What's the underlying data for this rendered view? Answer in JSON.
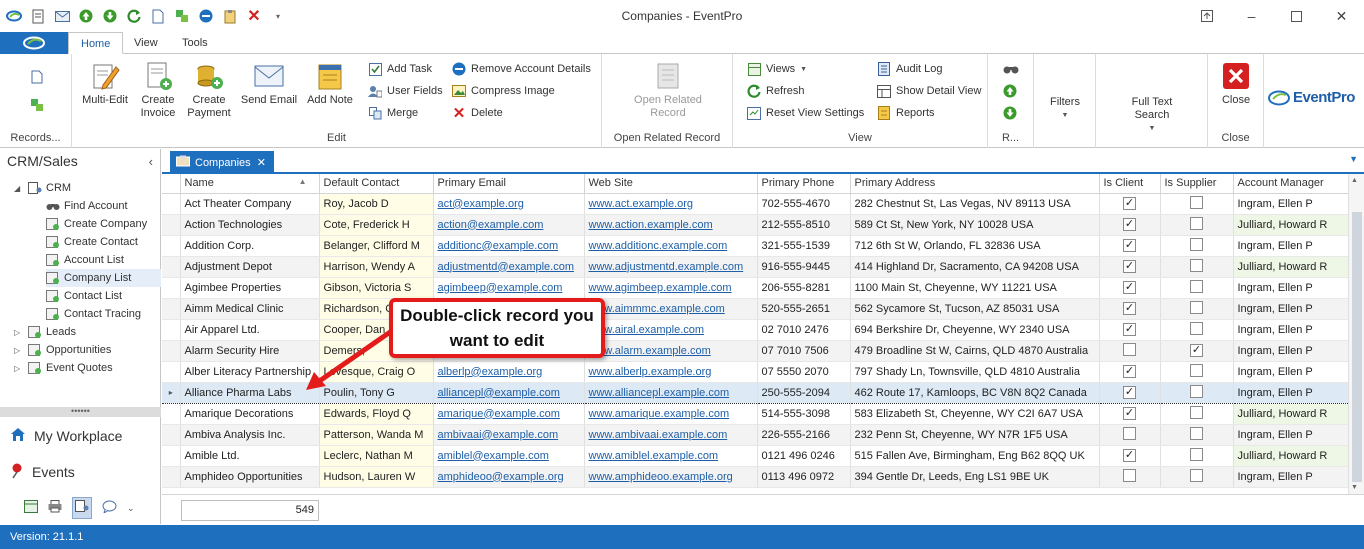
{
  "window": {
    "title": "Companies - EventPro"
  },
  "ribbon_tabs": [
    "Home",
    "View",
    "Tools"
  ],
  "ribbon": {
    "records_group": {
      "label": "Records..."
    },
    "edit_group": {
      "label": "Edit",
      "multi_edit": "Multi-Edit",
      "create_invoice": "Create\nInvoice",
      "create_payment": "Create\nPayment",
      "send_email": "Send Email",
      "add_note": "Add Note",
      "add_task": "Add Task",
      "user_fields": "User Fields",
      "merge": "Merge",
      "remove_account_details": "Remove Account Details",
      "compress_image": "Compress Image",
      "delete": "Delete"
    },
    "open_related_group": {
      "label": "Open Related Record",
      "open_related": "Open Related\nRecord"
    },
    "view_group": {
      "label": "View",
      "views": "Views",
      "refresh": "Refresh",
      "reset_view_settings": "Reset View Settings",
      "audit_log": "Audit Log",
      "show_detail_view": "Show Detail View",
      "reports": "Reports"
    },
    "r_group": {
      "label": "R..."
    },
    "filters": "Filters",
    "full_text_search": "Full Text\nSearch",
    "close_group": {
      "label": "Close",
      "close": "Close"
    },
    "logo": "EventPro"
  },
  "nav": {
    "header": "CRM/Sales",
    "tree": [
      {
        "label": "CRM",
        "icon": "crm-icon"
      },
      {
        "label": "Find Account",
        "icon": "binoculars-icon"
      },
      {
        "label": "Create Company",
        "icon": "create-company-icon"
      },
      {
        "label": "Create Contact",
        "icon": "create-contact-icon"
      },
      {
        "label": "Account List",
        "icon": "account-list-icon"
      },
      {
        "label": "Company List",
        "icon": "company-list-icon",
        "selected": true
      },
      {
        "label": "Contact List",
        "icon": "contact-list-icon"
      },
      {
        "label": "Contact Tracing",
        "icon": "contact-tracing-icon"
      },
      {
        "label": "Leads",
        "icon": "leads-icon"
      },
      {
        "label": "Opportunities",
        "icon": "opportunities-icon"
      },
      {
        "label": "Event Quotes",
        "icon": "event-quotes-icon"
      }
    ],
    "my_workplace": "My Workplace",
    "events": "Events"
  },
  "doc_tab": {
    "label": "Companies"
  },
  "grid": {
    "columns": [
      "Name",
      "Default Contact",
      "Primary Email",
      "Web Site",
      "Primary Phone",
      "Primary Address",
      "Is Client",
      "Is Supplier",
      "Account Manager"
    ],
    "rows": [
      [
        "Act Theater Company",
        "Roy, Jacob D",
        "act@example.org",
        "www.act.example.org",
        "702-555-4670",
        "282 Chestnut St, Las Vegas, NV 89113 USA",
        true,
        false,
        "Ingram, Ellen P"
      ],
      [
        "Action Technologies",
        "Cote, Frederick H",
        "action@example.com",
        "www.action.example.com",
        "212-555-8510",
        "589 Ct St, New York, NY 10028 USA",
        true,
        false,
        "Julliard, Howard R"
      ],
      [
        "Addition Corp.",
        "Belanger, Clifford M",
        "additionc@example.com",
        "www.additionc.example.com",
        "321-555-1539",
        "712 6th St W, Orlando, FL 32836 USA",
        true,
        false,
        "Ingram, Ellen P"
      ],
      [
        "Adjustment Depot",
        "Harrison, Wendy A",
        "adjustmentd@example.com",
        "www.adjustmentd.example.com",
        "916-555-9445",
        "414 Highland Dr, Sacramento, CA 94208 USA",
        true,
        false,
        "Julliard, Howard R"
      ],
      [
        "Agimbee Properties",
        "Gibson, Victoria S",
        "agimbeep@example.com",
        "www.agimbeep.example.com",
        "206-555-8281",
        "1100 Main St, Cheyenne, WY 11221 USA",
        true,
        false,
        "Ingram, Ellen P"
      ],
      [
        "Aimm Medical Clinic",
        "Richardson, C",
        "",
        "www.aimmmc.example.com",
        "520-555-2651",
        "562 Sycamore St, Tucson, AZ 85031 USA",
        true,
        false,
        "Ingram, Ellen P"
      ],
      [
        "Air Apparel Ltd.",
        "Cooper, Dan",
        "",
        "www.airal.example.com",
        "02 7010 2476",
        "694 Berkshire Dr, Cheyenne, WY 2340 USA",
        true,
        false,
        "Ingram, Ellen P"
      ],
      [
        "Alarm Security Hire",
        "Demers, ",
        "",
        "www.alarm.example.com",
        "07 7010 7506",
        "479 Broadline St W, Cairns, QLD 4870 Australia",
        false,
        true,
        "Ingram, Ellen P"
      ],
      [
        "Alber Literacy Partnership",
        "Levesque, Craig O",
        "alberlp@example.org",
        "www.alberlp.example.org",
        "07 5550 2070",
        "797 Shady Ln, Townsville, QLD 4810 Australia",
        true,
        false,
        "Ingram, Ellen P"
      ],
      [
        "Alliance Pharma Labs",
        "Poulin, Tony G",
        "alliancepl@example.com",
        "www.alliancepl.example.com",
        "250-555-2094",
        "462 Route 17, Kamloops, BC V8N 8Q2 Canada",
        true,
        false,
        "Ingram, Ellen P"
      ],
      [
        "Amarique Decorations",
        "Edwards, Floyd Q",
        "amarique@example.com",
        "www.amarique.example.com",
        "514-555-3098",
        "583 Elizabeth St, Cheyenne, WY C2I 6A7 USA",
        true,
        false,
        "Julliard, Howard R"
      ],
      [
        "Ambiva Analysis Inc.",
        "Patterson, Wanda M",
        "ambivaai@example.com",
        "www.ambivaai.example.com",
        "226-555-2166",
        "232 Penn St, Cheyenne, WY N7R 1F5 USA",
        false,
        false,
        "Ingram, Ellen P"
      ],
      [
        "Amible Ltd.",
        "Leclerc, Nathan M",
        "amiblel@example.com",
        "www.amiblel.example.com",
        "0121 496 0246",
        "515 Fallen Ave, Birmingham, Eng B62 8QQ UK",
        true,
        false,
        "Julliard, Howard R"
      ],
      [
        "Amphideo Opportunities",
        "Hudson, Lauren W",
        "amphideoo@example.org",
        "www.amphideoo.example.org",
        "0113 496 0972",
        "394 Gentle Dr, Leeds, Eng LS1 9BE UK",
        false,
        false,
        "Ingram, Ellen P"
      ]
    ],
    "selected_row": 9,
    "record_count": "549"
  },
  "callout": {
    "text": "Double-click record you want to edit"
  },
  "status": {
    "version": "Version: 21.1.1"
  },
  "colors": {
    "accent": "#1f6fbf",
    "callout_border": "#e31b1b",
    "selected_row": "#ddeaf6",
    "contact_cell": "#fffde6",
    "manager_cell": "#eef7e6"
  }
}
